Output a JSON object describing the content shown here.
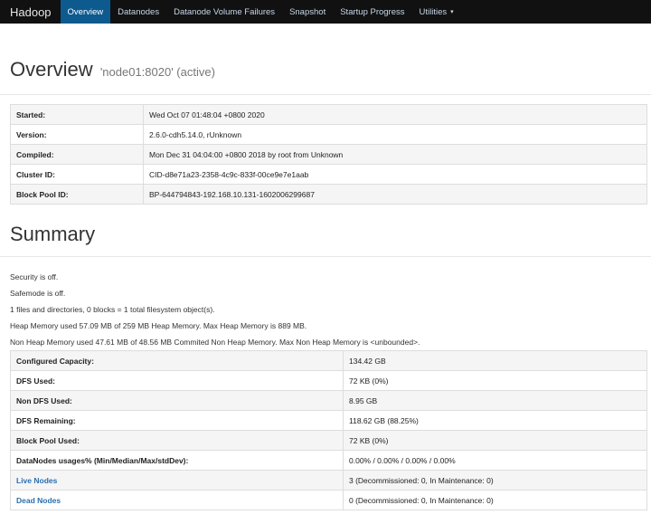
{
  "navbar": {
    "brand": "Hadoop",
    "items": [
      {
        "label": "Overview",
        "active": true
      },
      {
        "label": "Datanodes"
      },
      {
        "label": "Datanode Volume Failures"
      },
      {
        "label": "Snapshot"
      },
      {
        "label": "Startup Progress"
      },
      {
        "label": "Utilities"
      }
    ]
  },
  "overview": {
    "title": "Overview",
    "subtitle": "'node01:8020' (active)",
    "rows": [
      {
        "key": "Started:",
        "value": "Wed Oct 07 01:48:04 +0800 2020"
      },
      {
        "key": "Version:",
        "value": "2.6.0-cdh5.14.0, rUnknown"
      },
      {
        "key": "Compiled:",
        "value": "Mon Dec 31 04:04:00 +0800 2018 by root from Unknown"
      },
      {
        "key": "Cluster ID:",
        "value": "CID-d8e71a23-2358-4c9c-833f-00ce9e7e1aab"
      },
      {
        "key": "Block Pool ID:",
        "value": "BP-644794843-192.168.10.131-1602006299687"
      }
    ]
  },
  "summary": {
    "title": "Summary",
    "lines": [
      "Security is off.",
      "Safemode is off.",
      "1 files and directories, 0 blocks = 1 total filesystem object(s).",
      "Heap Memory used 57.09 MB of 259 MB Heap Memory. Max Heap Memory is 889 MB.",
      "Non Heap Memory used 47.61 MB of 48.56 MB Commited Non Heap Memory. Max Non Heap Memory is <unbounded>."
    ],
    "rows": [
      {
        "key": "Configured Capacity:",
        "value": "134.42 GB"
      },
      {
        "key": "DFS Used:",
        "value": "72 KB (0%)"
      },
      {
        "key": "Non DFS Used:",
        "value": "8.95 GB"
      },
      {
        "key": "DFS Remaining:",
        "value": "118.62 GB (88.25%)"
      },
      {
        "key": "Block Pool Used:",
        "value": "72 KB (0%)"
      },
      {
        "key": "DataNodes usages% (Min/Median/Max/stdDev):",
        "value": "0.00% / 0.00% / 0.00% / 0.00%"
      },
      {
        "key": "Live Nodes",
        "value": "3 (Decommissioned: 0, In Maintenance: 0)"
      },
      {
        "key": "Dead Nodes",
        "value": "0 (Decommissioned: 0, In Maintenance: 0)"
      }
    ]
  },
  "colors": {
    "navbar_bg": "#111111",
    "active_tab": "#0d5a8f",
    "link": "#2a6fb0"
  }
}
